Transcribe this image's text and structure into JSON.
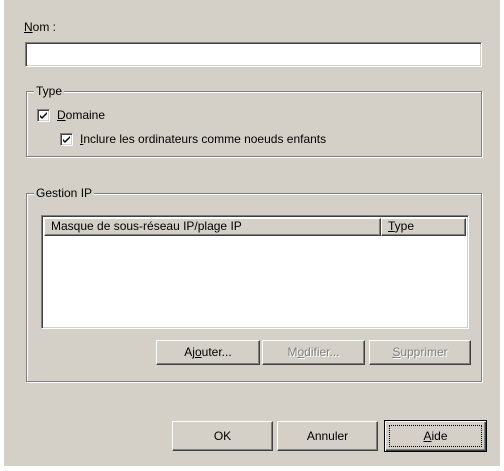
{
  "nom": {
    "label_mnemonic": "N",
    "label_rest": "om :",
    "value": ""
  },
  "type_group": {
    "title": "Type",
    "domaine": {
      "checked": true,
      "label_mnemonic": "D",
      "label_rest": "omaine"
    },
    "inclure": {
      "checked": true,
      "label_mnemonic": "I",
      "label_rest": "nclure les ordinateurs comme noeuds enfants"
    }
  },
  "gestion_ip": {
    "title": "Gestion IP",
    "columns": [
      {
        "label": "Masque de sous-réseau IP/plage IP"
      },
      {
        "label_mnemonic": "T",
        "label_rest": "ype"
      }
    ],
    "rows": [],
    "buttons": {
      "ajouter": {
        "pre": "Aj",
        "mnemonic": "o",
        "post": "uter...",
        "enabled": true
      },
      "modifier": {
        "pre": "M",
        "mnemonic": "o",
        "post": "difier...",
        "enabled": false
      },
      "supprimer": {
        "pre": "",
        "mnemonic": "S",
        "post": "upprimer",
        "enabled": false
      }
    }
  },
  "footer": {
    "ok": "OK",
    "annuler": "Annuler",
    "aide_mnemonic": "A",
    "aide_rest": "ide"
  },
  "colors": {
    "dialog_face": "#d4d0c8",
    "shadow": "#808080",
    "highlight": "#ffffff",
    "disabled_text": "#808080"
  }
}
